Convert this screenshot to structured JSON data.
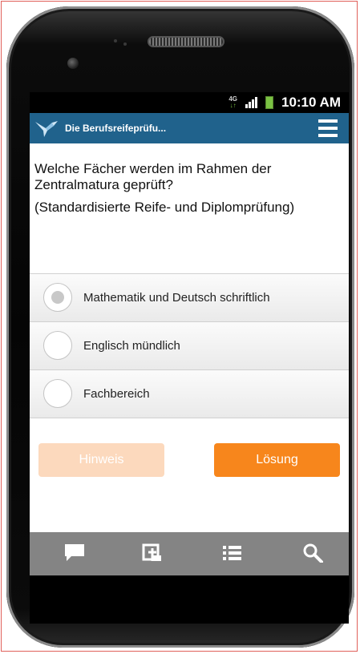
{
  "status_bar": {
    "network_type": "4G",
    "network_arrows": "↓↑",
    "time": "10:10 AM"
  },
  "app_bar": {
    "title": "Die Berufsreifeprüfu...",
    "logo_icon": "bird-logo-icon",
    "menu_icon": "hamburger-menu-icon"
  },
  "question": {
    "text": "Welche Fächer werden im Rahmen der Zentralmatura geprüft?",
    "subtext": "(Standardisierte Reife- und Diplomprüfung)"
  },
  "options": [
    {
      "label": "Mathematik und Deutsch schriftlich",
      "selected": true
    },
    {
      "label": "Englisch mündlich",
      "selected": false
    },
    {
      "label": "Fachbereich",
      "selected": false
    }
  ],
  "buttons": {
    "hint_label": "Hinweis",
    "solution_label": "Lösung"
  },
  "bottom_nav": [
    {
      "icon": "chat-icon"
    },
    {
      "icon": "add-note-icon"
    },
    {
      "icon": "list-icon"
    },
    {
      "icon": "search-icon"
    }
  ],
  "colors": {
    "app_bar": "#20628c",
    "solution_button": "#f7861c",
    "hint_button": "#fcd9bd",
    "bottom_bar": "#848484",
    "battery": "#7ac143"
  }
}
